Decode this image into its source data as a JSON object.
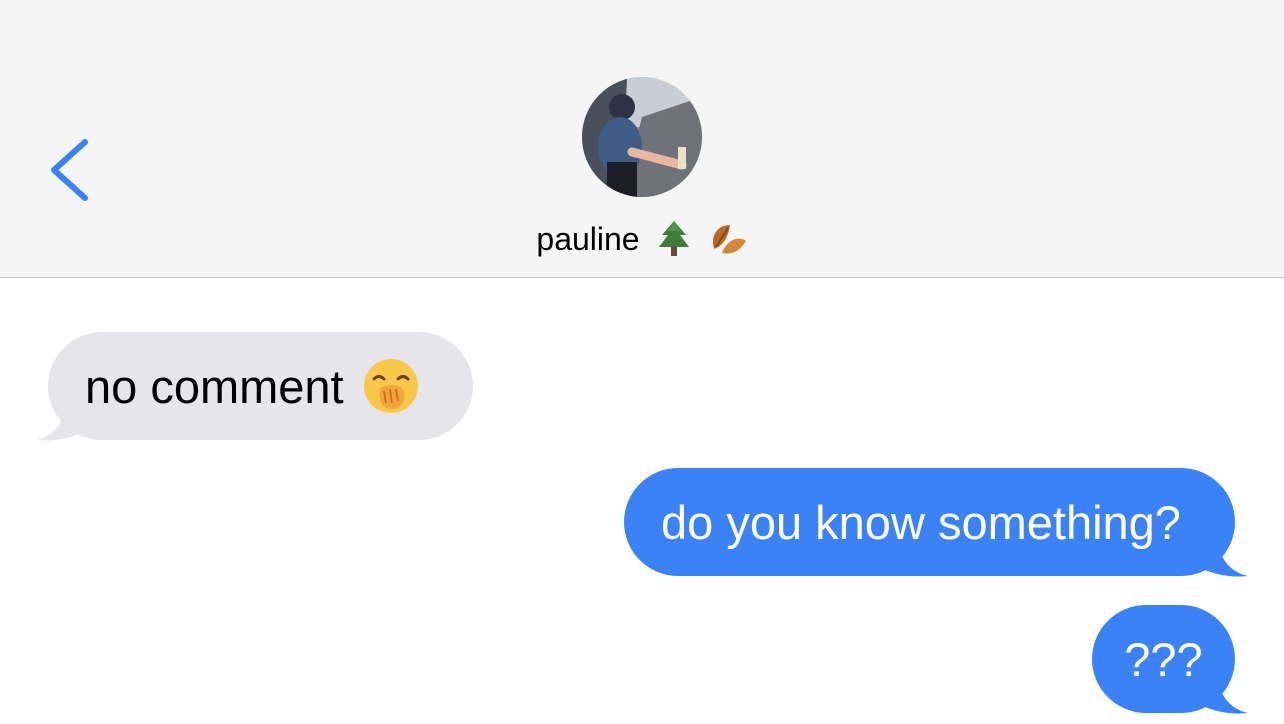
{
  "header": {
    "back_icon": "chevron-left-icon",
    "contact_name": "pauline",
    "contact_emojis": [
      "evergreen-tree-icon",
      "fallen-leaf-icon"
    ]
  },
  "colors": {
    "accent": "#3b82f6",
    "received_bubble": "#e5e5ea",
    "header_bg": "#f5f5f5"
  },
  "messages": [
    {
      "direction": "received",
      "text": "no comment",
      "emoji": "face-with-hand-over-mouth-icon"
    },
    {
      "direction": "sent",
      "text": "do you know something?"
    },
    {
      "direction": "sent",
      "text": "???"
    }
  ]
}
